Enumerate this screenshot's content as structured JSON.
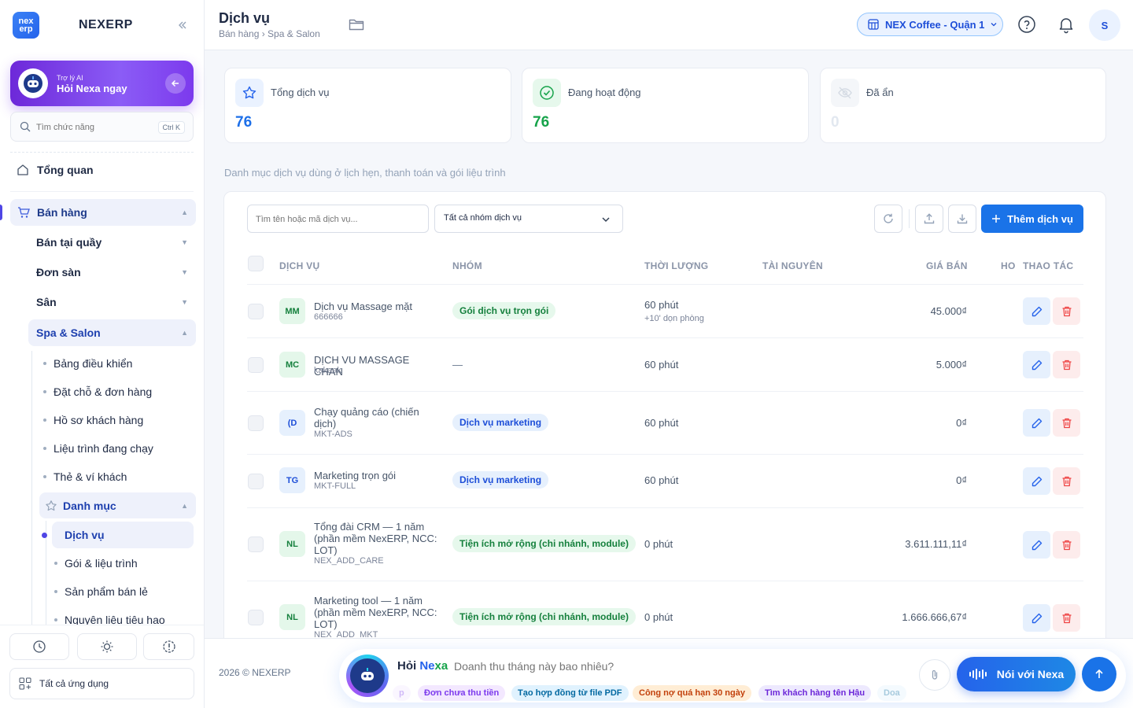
{
  "app": {
    "logo_text": "nex erp",
    "brand": "NEXERP"
  },
  "ai_card": {
    "subtitle": "Trợ lý AI",
    "title": "Hỏi Nexa ngay"
  },
  "sidebar": {
    "search_placeholder": "Tìm chức năng",
    "search_shortcut": "Ctrl K",
    "overview": "Tổng quan",
    "section": "Bán hàng",
    "groups": [
      "Bán tại quầy",
      "Đơn sàn",
      "Sân",
      "Spa & Salon"
    ],
    "spa_items": [
      "Bảng điều khiển",
      "Đặt chỗ & đơn hàng",
      "Hồ sơ khách hàng",
      "Liệu trình đang chạy",
      "Thẻ & ví khách"
    ],
    "catalog": "Danh mục",
    "catalog_items": [
      "Dịch vụ",
      "Gói & liệu trình",
      "Sản phẩm bán lẻ",
      "Nguyên liệu tiêu hao"
    ],
    "all_apps": "Tất cả ứng dụng"
  },
  "header": {
    "title": "Dịch vụ",
    "breadcrumb": "Bán hàng › Spa & Salon",
    "branch": "NEX Coffee - Quận 1",
    "avatar": "S"
  },
  "stats": [
    {
      "label": "Tổng dịch vụ",
      "value": "76",
      "color": "#1d6fe8"
    },
    {
      "label": "Đang hoạt động",
      "value": "76",
      "color": "#16a34a"
    },
    {
      "label": "Đã ẩn",
      "value": "0",
      "color": "#e2e8f0"
    }
  ],
  "description": "Danh mục dịch vụ dùng ở lịch hẹn, thanh toán và gói liệu trình",
  "toolbar": {
    "search_placeholder": "Tìm tên hoặc mã dịch vụ...",
    "group_filter": "Tất cả nhóm dịch vụ",
    "add_button": "Thêm dịch vụ"
  },
  "table": {
    "headers": {
      "service": "DỊCH VỤ",
      "group": "NHÓM",
      "duration": "THỜI LƯỢNG",
      "resource": "TÀI NGUYÊN",
      "price": "GIÁ BÁN",
      "hoa": "HO",
      "actions": "THAO TÁC"
    },
    "rows": [
      {
        "initials": "MM",
        "name": "Dịch vụ Massage mặt",
        "code": "666666",
        "group": "Gói dịch vụ trọn gói",
        "duration": "60 phút",
        "duration_extra": "+10' dọn phòng",
        "price": "45.000₫"
      },
      {
        "initials": "MC",
        "name": "DỊCH VU MASSAGE CHAN",
        "code": "kakaak",
        "group": "—",
        "duration": "60 phút",
        "duration_extra": "",
        "price": "5.000₫"
      },
      {
        "initials": "(D",
        "name": "Chạy quảng cáo (chiến dịch)",
        "code": "MKT-ADS",
        "group": "Dịch vụ marketing",
        "duration": "60 phút",
        "duration_extra": "",
        "price": "0₫"
      },
      {
        "initials": "TG",
        "name": "Marketing trọn gói",
        "code": "MKT-FULL",
        "group": "Dịch vụ marketing",
        "duration": "60 phút",
        "duration_extra": "",
        "price": "0₫"
      },
      {
        "initials": "NL",
        "name": "Tổng đài CRM — 1 năm (phần mềm NexERP, NCC: LOT)",
        "code": "NEX_ADD_CARE",
        "group": "Tiện ích mở rộng (chi nhánh, module)",
        "duration": "0 phút",
        "duration_extra": "",
        "price": "3.611.111,11₫"
      },
      {
        "initials": "NL",
        "name": "Marketing tool — 1 năm (phần mềm NexERP, NCC: LOT)",
        "code": "NEX_ADD_MKT",
        "group": "Tiện ích mở rộng (chi nhánh, module)",
        "duration": "0 phút",
        "duration_extra": "",
        "price": "1.666.666,67₫"
      }
    ]
  },
  "footer": {
    "copyright": "2026 © NEXERP",
    "ask": "Hỏi",
    "nexa_a": "Ne",
    "nexa_b": "xa",
    "question": "Doanh thu tháng này bao nhiêu?",
    "chips": [
      "p",
      "Đơn chưa thu tiền",
      "Tạo hợp đồng từ file PDF",
      "Công nợ quá hạn 30 ngày",
      "Tìm khách hàng tên Hậu",
      "Doa"
    ],
    "talk_button": "Nói với Nexa"
  }
}
